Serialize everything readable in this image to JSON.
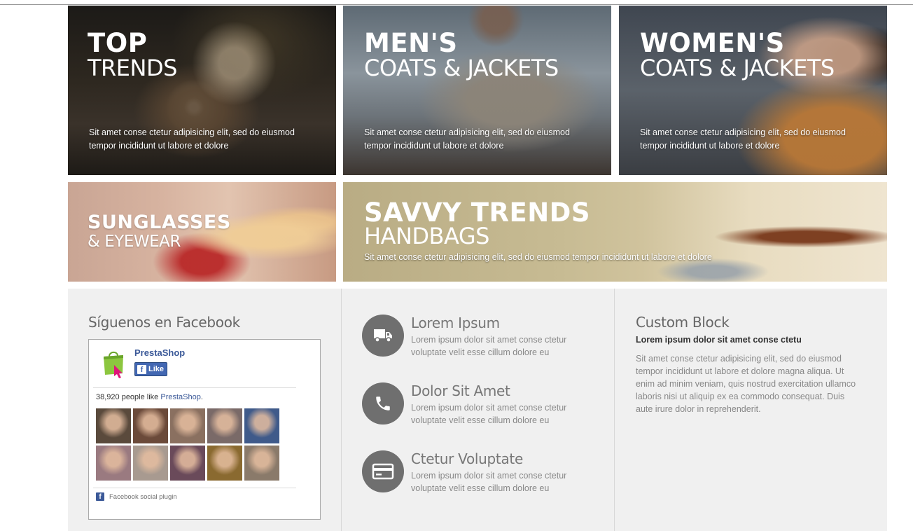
{
  "banners": [
    {
      "title": "TOP",
      "subtitle": "TRENDS",
      "description_line1": "Sit amet conse ctetur adipisicing elit, sed do eiusmod",
      "description_line2": "tempor incididunt ut labore et dolore"
    },
    {
      "title": "MEN'S",
      "subtitle": "COATS & JACKETS",
      "description_line1": "Sit amet conse ctetur adipisicing elit, sed do eiusmod",
      "description_line2": "tempor incididunt ut labore et dolore"
    },
    {
      "title": "WOMEN'S",
      "subtitle": "COATS & JACKETS",
      "description_line1": "Sit amet conse ctetur adipisicing elit, sed do eiusmod",
      "description_line2": "tempor incididunt ut labore et dolore"
    },
    {
      "title": "SUNGLASSES",
      "subtitle": "& EYEWEAR"
    },
    {
      "title": "SAVVY TRENDS",
      "subtitle": "HANDBAGS",
      "description": "Sit amet conse ctetur adipisicing elit, sed do eiusmod tempor incididunt ut labore et dolore"
    }
  ],
  "facebook": {
    "heading": "Síguenos en Facebook",
    "page_name": "PrestaShop",
    "like_label": "Like",
    "fb_glyph": "f",
    "count_text": "38,920 people like ",
    "count_link": "PrestaShop",
    "count_suffix": ".",
    "plugin_label": "Facebook social plugin",
    "face_colors": [
      "#5a4a3c",
      "#6b4a3a",
      "#8a7060",
      "#7a6a68",
      "#3f5a8a",
      "#9a7a80",
      "#a89a90",
      "#6a4a5a",
      "#8a6a30",
      "#8a7a6a"
    ]
  },
  "features": [
    {
      "title": "Lorem Ipsum",
      "text": "Lorem ipsum dolor sit amet conse ctetur voluptate velit esse cillum dolore eu",
      "icon": "truck-icon"
    },
    {
      "title": "Dolor Sit Amet",
      "text": "Lorem ipsum dolor sit amet conse ctetur voluptate velit esse cillum dolore eu",
      "icon": "phone-icon"
    },
    {
      "title": "Ctetur Voluptate",
      "text": "Lorem ipsum dolor sit amet conse ctetur voluptate velit esse cillum dolore eu",
      "icon": "credit-card-icon"
    }
  ],
  "custom_block": {
    "heading": "Custom Block",
    "bold_text": "Lorem ipsum dolor sit amet conse ctetu",
    "text": "Sit amet conse ctetur adipisicing elit, sed do eiusmod tempor incididunt ut labore et dolore magna aliqua. Ut enim ad minim veniam, quis nostrud exercitation ullamco laboris nisi ut aliquip ex ea commodo consequat. Duis aute irure dolor in reprehenderit."
  },
  "colors": {
    "footer_bg": "#f0f0f0",
    "icon_circle": "#6f6f6f",
    "facebook_blue": "#3b5998"
  }
}
